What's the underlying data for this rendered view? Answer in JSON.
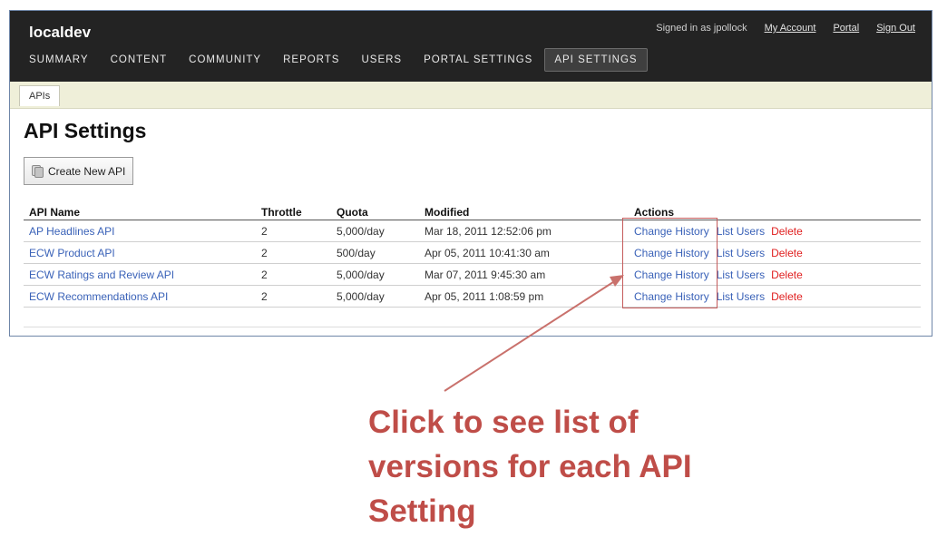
{
  "header": {
    "brand": "localdev",
    "signed_in_text": "Signed in as jpollock",
    "links": [
      "My Account",
      "Portal",
      "Sign Out"
    ]
  },
  "nav": {
    "items": [
      "SUMMARY",
      "CONTENT",
      "COMMUNITY",
      "REPORTS",
      "USERS",
      "PORTAL SETTINGS",
      "API SETTINGS"
    ],
    "active": "API SETTINGS"
  },
  "subnav": {
    "tab": "APIs"
  },
  "page": {
    "title": "API Settings",
    "create_button": "Create New API",
    "create_button_icon": "database-icon"
  },
  "table": {
    "headers": [
      "API Name",
      "Throttle",
      "Quota",
      "Modified",
      "Actions"
    ],
    "rows": [
      {
        "name": "AP Headlines API",
        "throttle": "2",
        "quota": "5,000/day",
        "modified": "Mar 18, 2011 12:52:06 pm"
      },
      {
        "name": "ECW Product API",
        "throttle": "2",
        "quota": "500/day",
        "modified": "Apr 05, 2011 10:41:30 am"
      },
      {
        "name": "ECW Ratings and Review API",
        "throttle": "2",
        "quota": "5,000/day",
        "modified": "Mar 07, 2011 9:45:30 am"
      },
      {
        "name": "ECW Recommendations API",
        "throttle": "2",
        "quota": "5,000/day",
        "modified": "Apr 05, 2011 1:08:59 pm"
      }
    ],
    "actions": [
      "Change History",
      "List Users",
      "Delete"
    ]
  },
  "annotation": {
    "lines": [
      "Click to see list of",
      "versions for each API",
      "Setting"
    ],
    "color": "#bf4d48"
  },
  "colors": {
    "topbar": "#232323",
    "link": "#3a62b8",
    "delete": "#e02020",
    "subbar": "#efefd9"
  }
}
